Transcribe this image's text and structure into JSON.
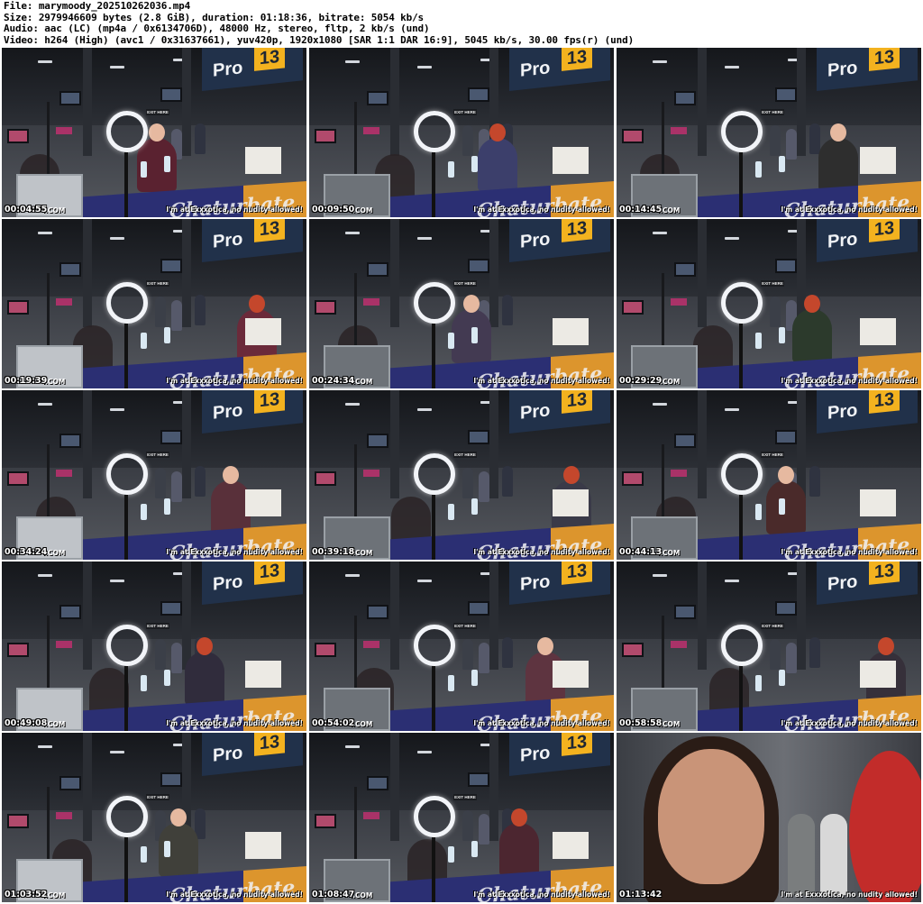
{
  "header": {
    "file": "File: marymoody_202510262036.mp4",
    "size": "Size: 2979946609 bytes (2.8 GiB), duration: 01:18:36, bitrate: 5054 kb/s",
    "audio": "Audio: aac (LC) (mp4a / 0x6134706D), 48000 Hz, stereo, fltp, 2 kb/s (und)",
    "video": "Video: h264 (High) (avc1 / 0x31637661), yuv420p, 1920x1080 [SAR 1:1 DAR 16:9], 5045 kb/s, 30.00 fps(r) (und)"
  },
  "scene_text": {
    "pro": "Pro",
    "pro_num": "13",
    "exit": "EXIT HERE",
    "table_logo": "Chaturbate"
  },
  "watermark": "Y.COM",
  "caption": "I'm at Exxxotica, no nudity allowed!",
  "thumbnails": [
    {
      "time": "00:04:55"
    },
    {
      "time": "00:09:50"
    },
    {
      "time": "00:14:45"
    },
    {
      "time": "00:19:39"
    },
    {
      "time": "00:24:34"
    },
    {
      "time": "00:29:29"
    },
    {
      "time": "00:34:24"
    },
    {
      "time": "00:39:18"
    },
    {
      "time": "00:44:13"
    },
    {
      "time": "00:49:08"
    },
    {
      "time": "00:54:02"
    },
    {
      "time": "00:58:58"
    },
    {
      "time": "01:03:52"
    },
    {
      "time": "01:08:47"
    },
    {
      "time": "01:13:42"
    }
  ]
}
